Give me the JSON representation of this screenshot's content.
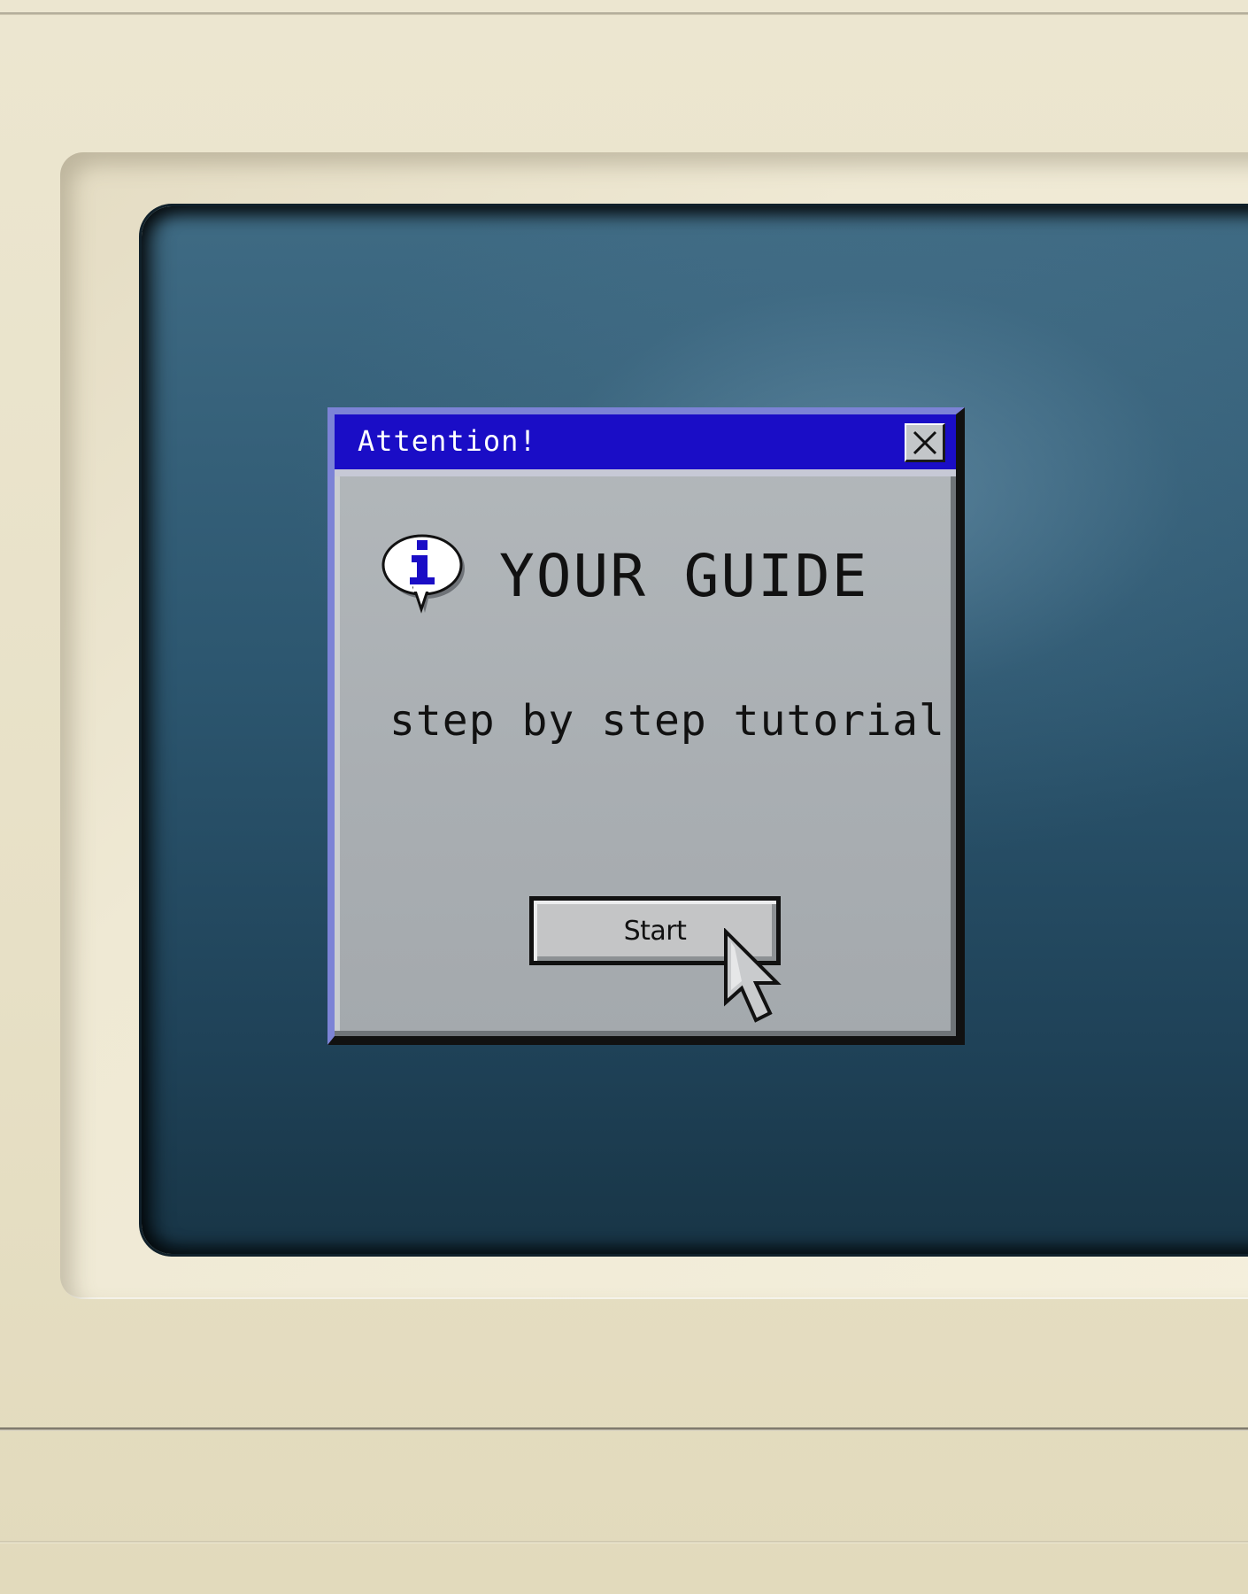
{
  "dialog": {
    "title": "Attention!",
    "heading": "YOUR GUIDE",
    "subtitle": "step by step tutorial",
    "start_label": "Start"
  },
  "icons": {
    "close": "close-icon",
    "info": "info-speech-bubble-icon",
    "pointer": "mouse-pointer-icon"
  },
  "colors": {
    "titlebar": "#1a0dc6",
    "dialog_face": "#a9aeb2",
    "screen": "#2c566f",
    "housing": "#e9e2c9"
  }
}
